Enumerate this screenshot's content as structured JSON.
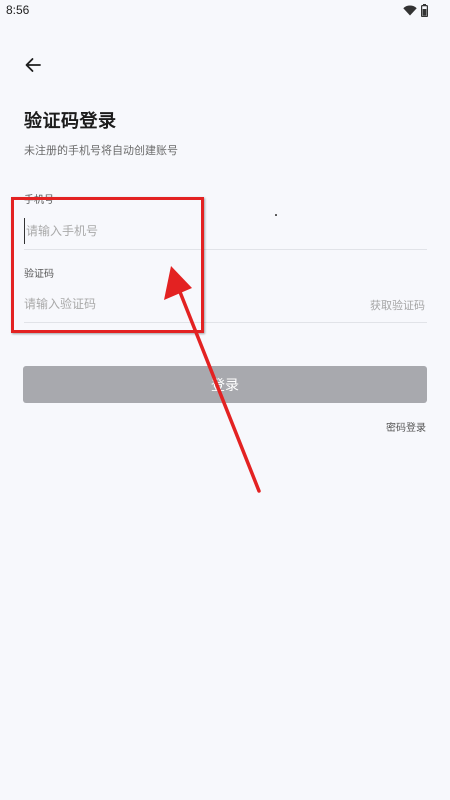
{
  "status_bar": {
    "time": "8:56",
    "icons": [
      "wifi-icon",
      "battery-icon"
    ]
  },
  "header": {
    "back_icon": "arrow-left-icon",
    "title": "验证码登录",
    "subtitle": "未注册的手机号将自动创建账号"
  },
  "form": {
    "phone": {
      "label": "手机号",
      "value": "",
      "placeholder": "请输入手机号"
    },
    "code": {
      "label": "验证码",
      "value": "",
      "placeholder": "请输入验证码",
      "get_code_label": "获取验证码"
    },
    "login_label": "登录",
    "password_login_label": "密码登录"
  },
  "annotation": {
    "color": "#e32222",
    "shapes": [
      "highlight-box",
      "arrow"
    ]
  },
  "colors": {
    "background": "#f7f8fc",
    "button_disabled": "#a8a9ae",
    "placeholder": "#a9a9a9"
  }
}
